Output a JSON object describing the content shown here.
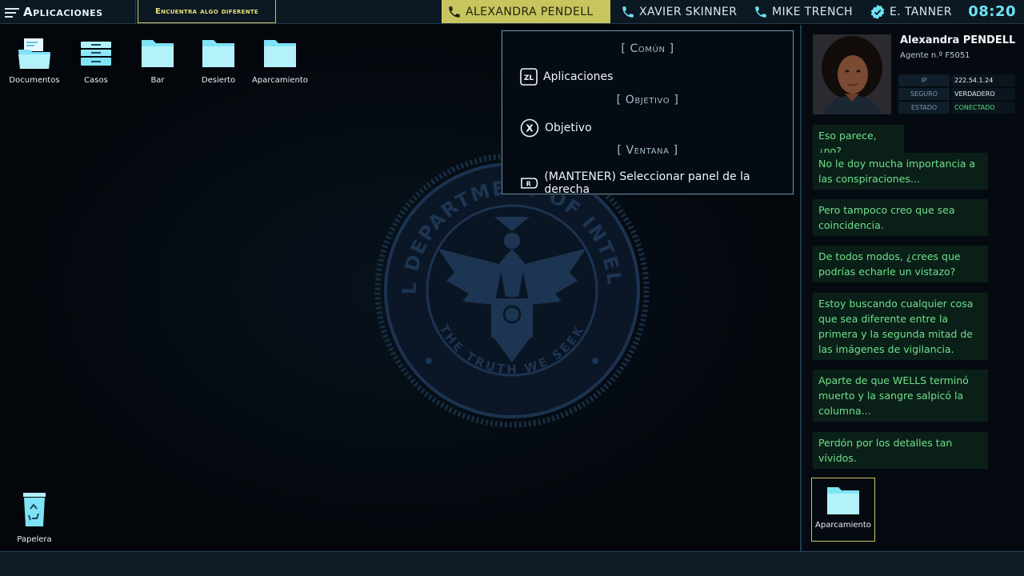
{
  "topbar": {
    "apps_label": "Aplicaciones",
    "task_label": "Encuentra algo diferente",
    "contacts": [
      {
        "name": "ALEXANDRA PENDELL",
        "active": true,
        "icon": "phone-icon"
      },
      {
        "name": "XAVIER SKINNER",
        "active": false,
        "icon": "phone-icon"
      },
      {
        "name": "MIKE TRENCH",
        "active": false,
        "icon": "phone-icon"
      },
      {
        "name": "E. TANNER",
        "active": false,
        "icon": "badge-icon"
      }
    ],
    "clock": "08:20"
  },
  "desktop": {
    "icons": [
      {
        "label": "Documentos",
        "icon": "documents-folder-icon"
      },
      {
        "label": "Casos",
        "icon": "cases-tray-icon"
      },
      {
        "label": "Bar",
        "icon": "folder-icon"
      },
      {
        "label": "Desierto",
        "icon": "folder-icon"
      },
      {
        "label": "Aparcamiento",
        "icon": "folder-icon"
      }
    ],
    "trash_label": "Papelera",
    "seal": {
      "top_text": "FEDERAL DEPARTMENT OF INTELLIGENCE",
      "bottom_text": "THE TRUTH WE SEEK"
    }
  },
  "popup": {
    "section_common": "[   Común   ]",
    "row_apps_button": "ZL",
    "row_apps": "Aplicaciones",
    "section_objective": "[   Objetivo   ]",
    "row_objective_button": "X",
    "row_objective": "Objetivo",
    "section_window": "[   Ventana   ]",
    "row_window_button": "R",
    "row_window": "(MANTENER) Seleccionar panel de la derecha"
  },
  "agent": {
    "name": "Alexandra PENDELL",
    "id": "Agente n.º F5051",
    "info": [
      {
        "key": "IP",
        "value": "222.54.1.24"
      },
      {
        "key": "SEGURO",
        "value": "VERDADERO"
      },
      {
        "key": "ESTADO",
        "value": "CONECTADO"
      }
    ]
  },
  "chat": [
    "Eso parece, ¿no?",
    "No le doy mucha importancia a las conspiraciones...",
    "Pero tampoco creo que sea coincidencia.",
    "De todos modos, ¿crees que podrías echarle un vistazo?",
    "Estoy buscando cualquier cosa que sea diferente entre la primera y la segunda mitad de las imágenes de vigilancia.",
    "Aparte de que WELLS terminó muerto y la sangre salpicó la columna...",
    "Perdón por los detalles tan vívidos."
  ],
  "attachment": {
    "label": "Aparcamiento",
    "icon": "folder-icon"
  },
  "colors": {
    "accent_yellow": "#c9c55e",
    "clock_cyan": "#6ee3f5",
    "chat_green": "#6fe08a",
    "status_green": "#54e07a"
  }
}
